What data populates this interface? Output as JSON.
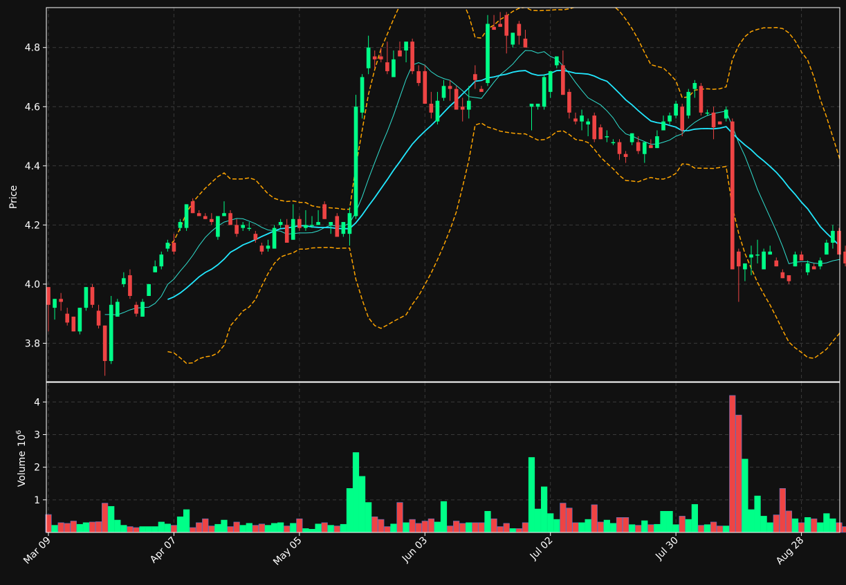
{
  "theme": {
    "background": "#111111",
    "axes_color": "#ffffff",
    "grid_color": "#3a3a3a",
    "up_color": "#00ff88",
    "down_color": "#ee4444",
    "ma_fast_color": "#30e0d0",
    "ma_slow_color": "#22e8ff",
    "band_color": "#ffa500"
  },
  "chart_data": {
    "type": "candlestick",
    "title": "",
    "ylabel": "Price",
    "volume_label": "Volume",
    "volume_exponent_base": "10",
    "volume_exponent": "6",
    "ylim": [
      3.67,
      4.935
    ],
    "volume_ylim": [
      0,
      4.6
    ],
    "yticks": [
      3.8,
      4.0,
      4.2,
      4.4,
      4.6,
      4.8
    ],
    "volume_yticks": [
      1,
      2,
      3,
      4
    ],
    "x_ticks": [
      {
        "index": 0,
        "label": "Mar 09"
      },
      {
        "index": 20,
        "label": "Apr 07"
      },
      {
        "index": 40,
        "label": "May 05"
      },
      {
        "index": 60,
        "label": "Jun 03"
      },
      {
        "index": 80,
        "label": "Jul 02"
      },
      {
        "index": 100,
        "label": "Jul 30"
      },
      {
        "index": 120,
        "label": "Aug 28"
      }
    ],
    "grid": true,
    "legend": "none",
    "bar_count": 127,
    "candles": [
      [
        3.99,
        3.99,
        3.84,
        3.93
      ],
      [
        3.92,
        3.95,
        3.88,
        3.95
      ],
      [
        3.95,
        3.97,
        3.91,
        3.94
      ],
      [
        3.9,
        3.92,
        3.86,
        3.87
      ],
      [
        3.89,
        3.89,
        3.84,
        3.84
      ],
      [
        3.84,
        3.92,
        3.83,
        3.92
      ],
      [
        3.92,
        3.99,
        3.91,
        3.99
      ],
      [
        3.99,
        4.0,
        3.92,
        3.93
      ],
      [
        3.91,
        3.93,
        3.85,
        3.86
      ],
      [
        3.86,
        3.86,
        3.69,
        3.74
      ],
      [
        3.74,
        3.96,
        3.73,
        3.93
      ],
      [
        3.89,
        3.95,
        3.89,
        3.94
      ],
      [
        4.0,
        4.04,
        3.99,
        4.02
      ],
      [
        4.03,
        4.05,
        3.95,
        3.96
      ],
      [
        3.93,
        3.94,
        3.89,
        3.9
      ],
      [
        3.89,
        3.95,
        3.89,
        3.94
      ],
      [
        3.96,
        4.0,
        3.96,
        4.0
      ],
      [
        4.04,
        4.08,
        4.04,
        4.06
      ],
      [
        4.06,
        4.11,
        4.05,
        4.1
      ],
      [
        4.12,
        4.15,
        4.11,
        4.14
      ],
      [
        4.14,
        4.17,
        4.1,
        4.11
      ],
      [
        4.19,
        4.22,
        4.18,
        4.21
      ],
      [
        4.19,
        4.27,
        4.18,
        4.27
      ],
      [
        4.28,
        4.29,
        4.24,
        4.24
      ],
      [
        4.24,
        4.25,
        4.23,
        4.23
      ],
      [
        4.23,
        4.24,
        4.22,
        4.22
      ],
      [
        4.22,
        4.24,
        4.2,
        4.21
      ],
      [
        4.16,
        4.23,
        4.15,
        4.23
      ],
      [
        4.23,
        4.28,
        4.23,
        4.24
      ],
      [
        4.24,
        4.25,
        4.21,
        4.2
      ],
      [
        4.2,
        4.22,
        4.16,
        4.17
      ],
      [
        4.19,
        4.21,
        4.18,
        4.2
      ],
      [
        4.19,
        4.21,
        4.18,
        4.19
      ],
      [
        4.17,
        4.18,
        4.14,
        4.15
      ],
      [
        4.13,
        4.14,
        4.1,
        4.11
      ],
      [
        4.12,
        4.15,
        4.11,
        4.13
      ],
      [
        4.12,
        4.2,
        4.12,
        4.19
      ],
      [
        4.2,
        4.22,
        4.19,
        4.21
      ],
      [
        4.2,
        4.22,
        4.14,
        4.14
      ],
      [
        4.15,
        4.27,
        4.15,
        4.22
      ],
      [
        4.22,
        4.23,
        4.18,
        4.19
      ],
      [
        4.19,
        4.25,
        4.18,
        4.2
      ],
      [
        4.2,
        4.23,
        4.19,
        4.2
      ],
      [
        4.2,
        4.25,
        4.2,
        4.21
      ],
      [
        4.27,
        4.28,
        4.22,
        4.22
      ],
      [
        4.2,
        4.21,
        4.17,
        4.21
      ],
      [
        4.23,
        4.24,
        4.16,
        4.16
      ],
      [
        4.17,
        4.21,
        4.16,
        4.21
      ],
      [
        4.17,
        4.26,
        4.13,
        4.24
      ],
      [
        4.23,
        4.64,
        4.22,
        4.6
      ],
      [
        4.58,
        4.71,
        4.56,
        4.7
      ],
      [
        4.73,
        4.84,
        4.71,
        4.8
      ],
      [
        4.77,
        4.79,
        4.73,
        4.76
      ],
      [
        4.77,
        4.8,
        4.75,
        4.76
      ],
      [
        4.75,
        4.82,
        4.71,
        4.72
      ],
      [
        4.7,
        4.79,
        4.7,
        4.76
      ],
      [
        4.79,
        4.82,
        4.77,
        4.77
      ],
      [
        4.79,
        4.81,
        4.75,
        4.82
      ],
      [
        4.82,
        4.83,
        4.71,
        4.72
      ],
      [
        4.72,
        4.74,
        4.67,
        4.68
      ],
      [
        4.72,
        4.74,
        4.61,
        4.61
      ],
      [
        4.61,
        4.65,
        4.56,
        4.58
      ],
      [
        4.55,
        4.65,
        4.54,
        4.62
      ],
      [
        4.63,
        4.69,
        4.62,
        4.67
      ],
      [
        4.67,
        4.69,
        4.62,
        4.66
      ],
      [
        4.66,
        4.67,
        4.59,
        4.59
      ],
      [
        4.6,
        4.63,
        4.55,
        4.59
      ],
      [
        4.59,
        4.67,
        4.56,
        4.62
      ],
      [
        4.71,
        4.74,
        4.66,
        4.69
      ],
      [
        4.66,
        4.67,
        4.65,
        4.65
      ],
      [
        4.68,
        4.91,
        4.67,
        4.88
      ],
      [
        4.87,
        4.91,
        4.86,
        4.86
      ],
      [
        4.88,
        4.92,
        4.87,
        4.87
      ],
      [
        4.91,
        4.92,
        4.78,
        4.84
      ],
      [
        4.81,
        4.85,
        4.8,
        4.85
      ],
      [
        4.88,
        4.89,
        4.81,
        4.84
      ],
      [
        4.83,
        4.86,
        4.81,
        4.8
      ],
      [
        4.6,
        4.61,
        4.52,
        4.61
      ],
      [
        4.6,
        4.61,
        4.59,
        4.61
      ],
      [
        4.6,
        4.71,
        4.59,
        4.7
      ],
      [
        4.65,
        4.72,
        4.63,
        4.72
      ],
      [
        4.74,
        4.76,
        4.73,
        4.77
      ],
      [
        4.74,
        4.79,
        4.64,
        4.64
      ],
      [
        4.65,
        4.66,
        4.56,
        4.58
      ],
      [
        4.56,
        4.58,
        4.54,
        4.55
      ],
      [
        4.55,
        4.59,
        4.52,
        4.57
      ],
      [
        4.54,
        4.56,
        4.5,
        4.55
      ],
      [
        4.57,
        4.58,
        4.48,
        4.49
      ],
      [
        4.53,
        4.54,
        4.49,
        4.49
      ],
      [
        4.5,
        4.52,
        4.48,
        4.5
      ],
      [
        4.48,
        4.49,
        4.47,
        4.48
      ],
      [
        4.48,
        4.49,
        4.42,
        4.44
      ],
      [
        4.44,
        4.45,
        4.41,
        4.43
      ],
      [
        4.48,
        4.51,
        4.47,
        4.51
      ],
      [
        4.48,
        4.5,
        4.44,
        4.45
      ],
      [
        4.44,
        4.48,
        4.41,
        4.48
      ],
      [
        4.47,
        4.49,
        4.46,
        4.46
      ],
      [
        4.46,
        4.52,
        4.46,
        4.5
      ],
      [
        4.52,
        4.57,
        4.52,
        4.55
      ],
      [
        4.55,
        4.58,
        4.54,
        4.57
      ],
      [
        4.57,
        4.62,
        4.56,
        4.61
      ],
      [
        4.6,
        4.61,
        4.5,
        4.52
      ],
      [
        4.57,
        4.66,
        4.56,
        4.65
      ],
      [
        4.66,
        4.69,
        4.63,
        4.68
      ],
      [
        4.67,
        4.68,
        4.57,
        4.58
      ],
      [
        4.58,
        4.59,
        4.57,
        4.58
      ],
      [
        4.58,
        4.6,
        4.49,
        4.53
      ],
      [
        4.55,
        4.55,
        4.54,
        4.54
      ],
      [
        4.56,
        4.6,
        4.55,
        4.59
      ],
      [
        4.55,
        4.56,
        4.05,
        4.05
      ],
      [
        4.11,
        4.12,
        3.94,
        4.06
      ],
      [
        4.05,
        4.07,
        4.01,
        4.07
      ],
      [
        4.09,
        4.13,
        4.03,
        4.1
      ],
      [
        4.1,
        4.15,
        4.07,
        4.1
      ],
      [
        4.05,
        4.12,
        4.05,
        4.11
      ],
      [
        4.1,
        4.13,
        4.1,
        4.11
      ],
      [
        4.08,
        4.09,
        4.06,
        4.06
      ],
      [
        4.04,
        4.05,
        4.02,
        4.02
      ],
      [
        4.03,
        4.03,
        4.0,
        4.01
      ],
      [
        4.06,
        4.11,
        4.06,
        4.1
      ],
      [
        4.1,
        4.11,
        4.08,
        4.08
      ],
      [
        4.04,
        4.08,
        4.03,
        4.07
      ],
      [
        4.06,
        4.07,
        4.05,
        4.05
      ],
      [
        4.06,
        4.09,
        4.05,
        4.08
      ],
      [
        4.1,
        4.15,
        4.1,
        4.14
      ],
      [
        4.14,
        4.2,
        4.12,
        4.18
      ],
      [
        4.18,
        4.19,
        4.1,
        4.1
      ],
      [
        4.11,
        4.13,
        4.06,
        4.07
      ]
    ],
    "volume": [
      0.55,
      0.22,
      0.3,
      0.28,
      0.35,
      0.25,
      0.3,
      0.32,
      0.33,
      0.9,
      0.8,
      0.38,
      0.22,
      0.18,
      0.15,
      0.18,
      0.18,
      0.18,
      0.32,
      0.26,
      0.22,
      0.48,
      0.7,
      0.15,
      0.3,
      0.42,
      0.2,
      0.25,
      0.38,
      0.18,
      0.32,
      0.22,
      0.28,
      0.22,
      0.26,
      0.22,
      0.28,
      0.3,
      0.2,
      0.28,
      0.42,
      0.12,
      0.1,
      0.26,
      0.3,
      0.22,
      0.2,
      0.25,
      1.35,
      2.45,
      1.72,
      0.92,
      0.48,
      0.4,
      0.18,
      0.26,
      0.92,
      0.3,
      0.4,
      0.28,
      0.35,
      0.42,
      0.32,
      0.95,
      0.2,
      0.35,
      0.28,
      0.3,
      0.3,
      0.3,
      0.65,
      0.42,
      0.18,
      0.28,
      0.12,
      0.12,
      0.3,
      2.3,
      0.72,
      1.4,
      0.58,
      0.4,
      0.9,
      0.75,
      0.3,
      0.3,
      0.4,
      0.85,
      0.32,
      0.38,
      0.28,
      0.46,
      0.46,
      0.24,
      0.22,
      0.36,
      0.24,
      0.25,
      0.65,
      0.65,
      0.24,
      0.5,
      0.4,
      0.86,
      0.22,
      0.24,
      0.32,
      0.2,
      0.2,
      4.2,
      3.6,
      2.25,
      0.7,
      1.12,
      0.5,
      0.3,
      0.54,
      1.35,
      0.66,
      0.42,
      0.3,
      0.46,
      0.42,
      0.3,
      0.58,
      0.42,
      0.3,
      0.18
    ]
  }
}
